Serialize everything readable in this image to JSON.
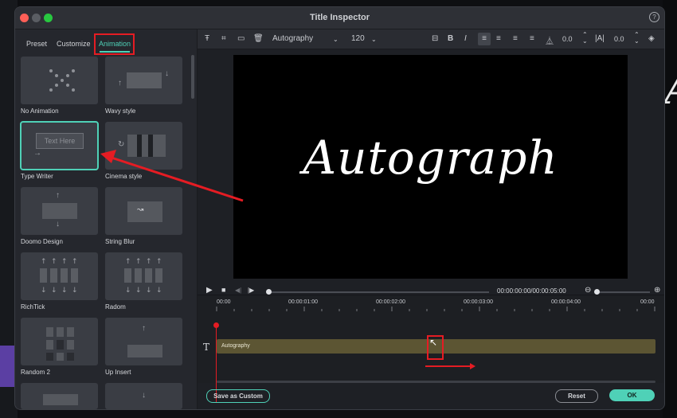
{
  "window": {
    "title": "Title Inspector"
  },
  "tabs": [
    {
      "label": "Preset",
      "active": false
    },
    {
      "label": "Customize",
      "active": false
    },
    {
      "label": "Animation",
      "active": true
    }
  ],
  "animations": [
    {
      "label": "No Animation"
    },
    {
      "label": "Wavy style"
    },
    {
      "label": "Type Writer",
      "preview_text": "Text Here",
      "selected": true
    },
    {
      "label": "Cinema style"
    },
    {
      "label": "Doomo Design"
    },
    {
      "label": "String Blur"
    },
    {
      "label": "RichTick"
    },
    {
      "label": "Radom"
    },
    {
      "label": "Random 2"
    },
    {
      "label": "Up Insert"
    }
  ],
  "toolbar": {
    "font": "Autography",
    "size": "120",
    "bold": "B",
    "italic": "I",
    "char_spacing": "0.0",
    "line_spacing": "0.0"
  },
  "preview": {
    "text": "Autograph"
  },
  "playback": {
    "timecode": "00:00:00:00/00:00:05:00"
  },
  "timeline": {
    "ticks": [
      "00:00",
      "00:00:01:00",
      "00:00:02:00",
      "00:00:03:00",
      "00:00:04:00",
      "00:00"
    ],
    "track_label": "Autography",
    "track_icon": "T"
  },
  "buttons": {
    "save_custom": "Save as Custom",
    "reset": "Reset",
    "ok": "OK"
  },
  "colors": {
    "accent": "#4fd1b7",
    "highlight_red": "#e51c23",
    "track": "#5c5533",
    "traffic_close": "#ff5f57",
    "traffic_min": "#5a5d63",
    "traffic_max": "#28c840"
  },
  "background": {
    "script_letter": "A"
  }
}
